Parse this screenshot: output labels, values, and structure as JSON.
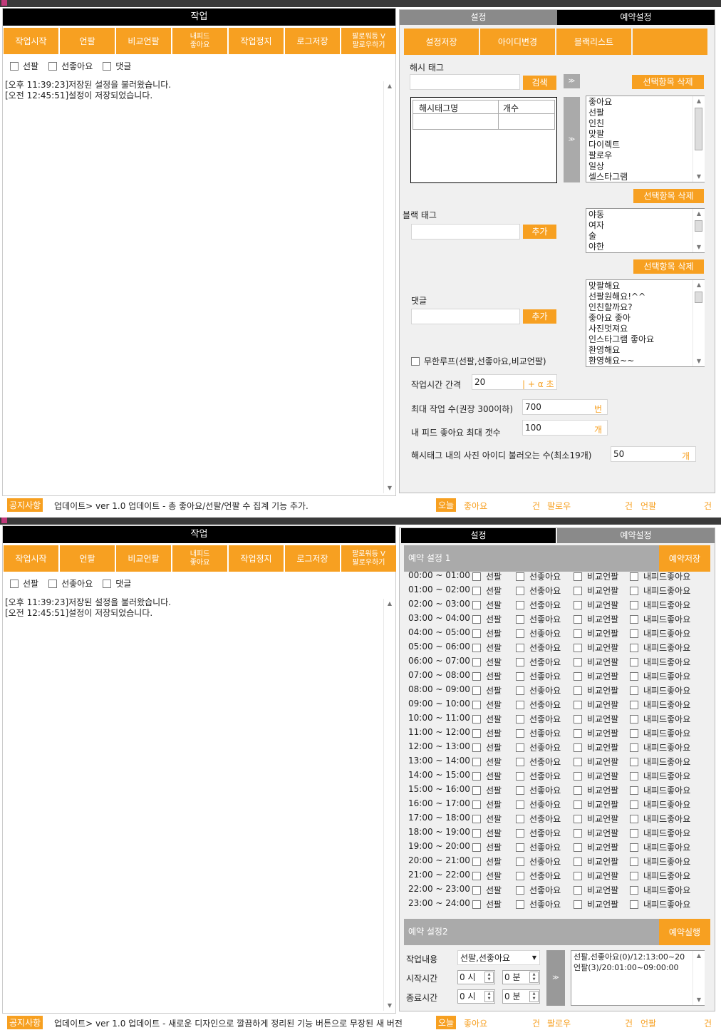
{
  "colors": {
    "accent": "#f7a021",
    "gray": "#aaaaaa",
    "black": "#000000"
  },
  "left": {
    "header": "작업",
    "buttons": [
      "작업시작",
      "언팔",
      "비교언팔",
      "내피드\n좋아요",
      "작업정지",
      "로그저장",
      "팔로워등 V\n팔로우하기"
    ],
    "checkboxes": [
      "선팔",
      "선좋아요",
      "댓글"
    ],
    "log": [
      "[오후 11:39:23]저장된 설정을 불러왔습니다.",
      "[오전 12:45:51]설정이 저장되었습니다."
    ]
  },
  "panel1": {
    "tabs": {
      "settings": "설정",
      "reserve": "예약설정"
    },
    "buttons": [
      "설정저장",
      "아이디변경",
      "블랙리스트",
      ""
    ],
    "hashtag_label": "해시 태그",
    "search_btn": "검색",
    "arrow": "≫",
    "delete_btn": "선택항목 삭제",
    "grid_headers": [
      "해시태그명",
      "개수"
    ],
    "hashtag_list": [
      "좋아요",
      "선팔",
      "인친",
      "맞팔",
      "다이렉트",
      "팔로우",
      "일상",
      "셀스타그램"
    ],
    "black_label": "블랙 태그",
    "add_btn": "추가",
    "black_list": [
      "야동",
      "여자",
      "술",
      "야한"
    ],
    "comment_label": "댓글",
    "comment_list": [
      "맞팔해요",
      "선팔원해요!^^",
      "인친할까요?",
      "좋아요 좋아",
      "사진멋져요",
      "인스타그램 좋아요",
      "환영해요",
      "환영해요~~"
    ],
    "infinite": "무한루프(선팔,선좋아요,비교언팔)",
    "interval_label": "작업시간 간격",
    "interval_value": "20",
    "interval_unit": "| + α 초",
    "max_label": "최대 작업 수(권장 300이하)",
    "max_value": "700",
    "max_unit": "번",
    "feed_label": "내 피드 좋아요 최대 갯수",
    "feed_value": "100",
    "feed_unit": "개",
    "photo_label": "해시태그 내의 사진 아이디 불러오는 수(최소19개)",
    "photo_value": "50",
    "photo_unit": "개"
  },
  "status1": {
    "notice": "공지사항",
    "text": "업데이트> ver 1.0 업데이트 - 총 좋아요/선팔/언팔 수 집계 기능 추가.",
    "today": "오늘",
    "like": "좋아요",
    "gun": "건",
    "follow": "팔로우",
    "unfollow": "언팔"
  },
  "panel2": {
    "reserve1": "예약 설정 1",
    "save_btn": "예약저장",
    "reserve2": "예약 설정2",
    "run_btn": "예약실행",
    "slots": [
      "00:00 ~ 01:00",
      "01:00 ~ 02:00",
      "02:00 ~ 03:00",
      "03:00 ~ 04:00",
      "04:00 ~ 05:00",
      "05:00 ~ 06:00",
      "06:00 ~ 07:00",
      "07:00 ~ 08:00",
      "08:00 ~ 09:00",
      "09:00 ~ 10:00",
      "10:00 ~ 11:00",
      "11:00 ~ 12:00",
      "12:00 ~ 13:00",
      "13:00 ~ 14:00",
      "14:00 ~ 15:00",
      "15:00 ~ 16:00",
      "16:00 ~ 17:00",
      "17:00 ~ 18:00",
      "18:00 ~ 19:00",
      "19:00 ~ 20:00",
      "20:00 ~ 21:00",
      "21:00 ~ 22:00",
      "22:00 ~ 23:00",
      "23:00 ~ 24:00"
    ],
    "options": [
      "선팔",
      "선좋아요",
      "비교언팔",
      "내피드좋아요"
    ],
    "content_label": "작업내용",
    "content_value": "선팔,선좋아요",
    "start_label": "시작시간",
    "end_label": "종료시간",
    "zero": "0",
    "hour": "시",
    "minute": "분",
    "arrow": "≫",
    "result": [
      "선팔,선좋아요(0)/12:13:00~20",
      "언팔(3)/20:01:00~09:00:00"
    ]
  },
  "status2": {
    "notice": "공지사항",
    "text": "업데이트> ver 1.0 업데이트 - 새로운 디자인으로 깔끔하게 정리된 기능 버튼으로 무장된 새 버전",
    "today": "오늘",
    "like": "좋아요",
    "gun": "건",
    "follow": "팔로우",
    "unfollow": "언팔"
  }
}
